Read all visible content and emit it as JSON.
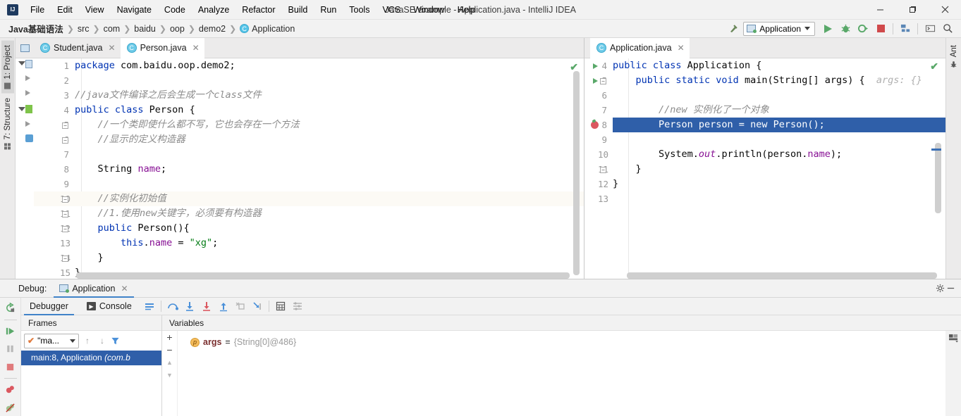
{
  "window": {
    "title": "JavaSE example - Application.java - IntelliJ IDEA",
    "minimize": "—",
    "maximize": "❐",
    "close": "✕"
  },
  "menubar": [
    {
      "label": "File"
    },
    {
      "label": "Edit"
    },
    {
      "label": "View"
    },
    {
      "label": "Navigate"
    },
    {
      "label": "Code"
    },
    {
      "label": "Analyze"
    },
    {
      "label": "Refactor"
    },
    {
      "label": "Build"
    },
    {
      "label": "Run"
    },
    {
      "label": "Tools"
    },
    {
      "label": "VCS"
    },
    {
      "label": "Window"
    },
    {
      "label": "Help"
    }
  ],
  "breadcrumb": {
    "separator": "❯",
    "items": [
      {
        "label": "Java基础语法",
        "icon": null
      },
      {
        "label": "src",
        "icon": null
      },
      {
        "label": "com",
        "icon": null
      },
      {
        "label": "baidu",
        "icon": null
      },
      {
        "label": "oop",
        "icon": null
      },
      {
        "label": "demo2",
        "icon": null
      },
      {
        "label": "Application",
        "icon": "class-icon"
      }
    ]
  },
  "toolbar": {
    "build_icon": "hammer-icon",
    "run_config": "Application",
    "run_icon": "run-icon",
    "debug_icon": "debug-icon",
    "run_coverage_icon": "run-with-coverage-icon",
    "stop_icon": "stop-icon",
    "project_structure_icon": "project-structure-icon",
    "terminal_icon": "terminal-icon",
    "search_icon": "search-icon"
  },
  "left_rail": {
    "tabs": [
      {
        "label": "1: Project",
        "icon": "project-folder-icon",
        "selected": true
      },
      {
        "label": "7: Structure",
        "icon": "structure-icon",
        "selected": false
      }
    ]
  },
  "right_rail": {
    "tabs": [
      {
        "label": "Ant",
        "icon": "ant-icon"
      }
    ]
  },
  "left_editor": {
    "tabs": [
      {
        "label": "Student.java",
        "icon": "class-icon",
        "active": false,
        "close": "✕"
      },
      {
        "label": "Person.java",
        "icon": "class-icon",
        "active": true,
        "close": "✕"
      }
    ],
    "status_check": "✔",
    "lines": [
      {
        "n": 1,
        "highlight": false,
        "fold": null,
        "tokens": [
          {
            "t": "package ",
            "c": "kw"
          },
          {
            "t": "com.baidu.oop.demo2;",
            "c": "plain"
          }
        ]
      },
      {
        "n": 2,
        "highlight": false,
        "fold": null,
        "tokens": []
      },
      {
        "n": 3,
        "highlight": false,
        "fold": null,
        "tokens": [
          {
            "t": "//java文件编译之后会生成一个class文件",
            "c": "cmt"
          }
        ]
      },
      {
        "n": 4,
        "highlight": false,
        "fold": null,
        "tokens": [
          {
            "t": "public class ",
            "c": "kw"
          },
          {
            "t": "Person {",
            "c": "plain"
          }
        ]
      },
      {
        "n": 5,
        "highlight": false,
        "fold": "minus",
        "tokens": [
          {
            "t": "    //一个类即使什么都不写，它也会存在一个方法",
            "c": "cmt"
          }
        ]
      },
      {
        "n": 6,
        "highlight": false,
        "fold": "minus",
        "tokens": [
          {
            "t": "    //显示的定义构造器",
            "c": "cmt"
          }
        ]
      },
      {
        "n": 7,
        "highlight": false,
        "fold": null,
        "tokens": []
      },
      {
        "n": 8,
        "highlight": false,
        "fold": null,
        "tokens": [
          {
            "t": "    ",
            "c": "plain"
          },
          {
            "t": "String",
            "c": "plain"
          },
          {
            "t": " ",
            "c": "plain"
          },
          {
            "t": "name",
            "c": "fld"
          },
          {
            "t": ";",
            "c": "plain"
          }
        ]
      },
      {
        "n": 9,
        "highlight": false,
        "fold": null,
        "tokens": []
      },
      {
        "n": 10,
        "highlight": true,
        "fold": "minus",
        "tokens": [
          {
            "t": "    //实例化初始值",
            "c": "cmt"
          }
        ]
      },
      {
        "n": 11,
        "highlight": false,
        "fold": "minus",
        "tokens": [
          {
            "t": "    //1.使用new关键字，必须要有构造器",
            "c": "cmt"
          }
        ]
      },
      {
        "n": 12,
        "highlight": false,
        "fold": "minus",
        "tokens": [
          {
            "t": "    ",
            "c": "plain"
          },
          {
            "t": "public ",
            "c": "kw"
          },
          {
            "t": "Person(){",
            "c": "plain"
          }
        ]
      },
      {
        "n": 13,
        "highlight": false,
        "fold": null,
        "tokens": [
          {
            "t": "        ",
            "c": "plain"
          },
          {
            "t": "this",
            "c": "kw"
          },
          {
            "t": ".",
            "c": "plain"
          },
          {
            "t": "name",
            "c": "fld"
          },
          {
            "t": " = ",
            "c": "plain"
          },
          {
            "t": "\"xg\"",
            "c": "str"
          },
          {
            "t": ";",
            "c": "plain"
          }
        ]
      },
      {
        "n": 14,
        "highlight": false,
        "fold": "minus",
        "tokens": [
          {
            "t": "    }",
            "c": "plain"
          }
        ]
      },
      {
        "n": 15,
        "highlight": false,
        "fold": null,
        "tokens": [
          {
            "t": "}",
            "c": "plain"
          }
        ]
      }
    ]
  },
  "right_editor": {
    "tabs": [
      {
        "label": "Application.java",
        "icon": "class-icon",
        "active": true,
        "close": "✕"
      }
    ],
    "status_check": "✔",
    "lines": [
      {
        "n": 4,
        "exec": false,
        "gutter": "run",
        "fold": null,
        "tokens": [
          {
            "t": "public class ",
            "c": "kw"
          },
          {
            "t": "Application {",
            "c": "plain"
          }
        ]
      },
      {
        "n": 5,
        "exec": false,
        "gutter": "run",
        "fold": "minus",
        "tokens": [
          {
            "t": "    ",
            "c": "plain"
          },
          {
            "t": "public static void ",
            "c": "kw"
          },
          {
            "t": "main(String[] args) {",
            "c": "plain"
          },
          {
            "t": "  args: {}",
            "c": "hint"
          }
        ]
      },
      {
        "n": 6,
        "exec": false,
        "gutter": null,
        "fold": null,
        "tokens": []
      },
      {
        "n": 7,
        "exec": false,
        "gutter": null,
        "fold": null,
        "tokens": [
          {
            "t": "        //new 实例化了一个对象",
            "c": "cmt"
          }
        ]
      },
      {
        "n": 8,
        "exec": true,
        "gutter": "breakpoint",
        "fold": null,
        "tokens": [
          {
            "t": "        Person person = ",
            "c": "plain"
          },
          {
            "t": "new ",
            "c": "kw"
          },
          {
            "t": "Person();",
            "c": "plain"
          }
        ]
      },
      {
        "n": 9,
        "exec": false,
        "gutter": null,
        "fold": null,
        "tokens": []
      },
      {
        "n": 10,
        "exec": false,
        "gutter": null,
        "fold": null,
        "tokens": [
          {
            "t": "        System.",
            "c": "plain"
          },
          {
            "t": "out",
            "c": "stat"
          },
          {
            "t": ".println(person.",
            "c": "plain"
          },
          {
            "t": "name",
            "c": "fld"
          },
          {
            "t": ");",
            "c": "plain"
          }
        ]
      },
      {
        "n": 11,
        "exec": false,
        "gutter": null,
        "fold": "minus",
        "tokens": [
          {
            "t": "    }",
            "c": "plain"
          }
        ]
      },
      {
        "n": 12,
        "exec": false,
        "gutter": null,
        "fold": null,
        "tokens": [
          {
            "t": "}",
            "c": "plain"
          }
        ]
      },
      {
        "n": 13,
        "exec": false,
        "gutter": null,
        "fold": null,
        "tokens": []
      }
    ]
  },
  "debug": {
    "header_label": "Debug:",
    "session_tab": "Application",
    "session_close": "✕",
    "settings_icon": "gear-icon",
    "hide_icon": "minimize-icon",
    "layout_icon": "layout-settings-icon",
    "side_buttons": [
      {
        "name": "rerun-button",
        "icon": "rerun-icon"
      },
      {
        "name": "resume-button",
        "icon": "resume-program-icon"
      },
      {
        "name": "pause-button",
        "icon": "pause-program-icon"
      },
      {
        "name": "stop-button",
        "icon": "stop-icon"
      },
      {
        "name": "view-breakpoints-button",
        "icon": "breakpoints-icon"
      },
      {
        "name": "mute-breakpoints-button",
        "icon": "mute-breakpoints-icon"
      }
    ],
    "tabs": [
      {
        "label": "Debugger",
        "icon": null,
        "active": true
      },
      {
        "label": "Console",
        "icon": "console-icon",
        "active": false
      }
    ],
    "step_buttons": [
      {
        "name": "show-execution-point-button",
        "icon": "execution-point-icon"
      },
      {
        "name": "step-over-button",
        "icon": "step-over-icon"
      },
      {
        "name": "step-into-button",
        "icon": "step-into-icon"
      },
      {
        "name": "force-step-into-button",
        "icon": "force-step-into-icon"
      },
      {
        "name": "step-out-button",
        "icon": "step-out-icon"
      },
      {
        "name": "drop-frame-button",
        "icon": "drop-frame-icon"
      },
      {
        "name": "run-to-cursor-button",
        "icon": "run-to-cursor-icon"
      },
      {
        "name": "evaluate-expression-button",
        "icon": "calculator-icon"
      },
      {
        "name": "settings-button",
        "icon": "sliders-icon"
      }
    ],
    "frames": {
      "header": "Frames",
      "thread_selector": "\"ma...",
      "thread_check": "✔",
      "up_icon": "↑",
      "down_icon": "↓",
      "filter_icon": "funnel-icon",
      "items": [
        {
          "label": "main:8, Application ",
          "qualifier": "(com.b",
          "selected": true
        }
      ]
    },
    "variables": {
      "header": "Variables",
      "add_icon": "+",
      "remove_icon": "−",
      "up_icon": "▲",
      "down_icon": "▼",
      "rows": [
        {
          "badge": "p",
          "name": "args",
          "eq": "=",
          "value": "{String[0]@486}"
        }
      ]
    }
  },
  "colors": {
    "accent_blue": "#2f5fa9",
    "tab_underline": "#4083c9",
    "run_green": "#59a869",
    "stop_red": "#d0494b",
    "breakpoint_red": "#db5860",
    "comment_gray": "#8c8c8c",
    "keyword_blue": "#0033b3",
    "string_green": "#067d17",
    "field_purple": "#871094",
    "caret_line": "#fcfaf5"
  }
}
